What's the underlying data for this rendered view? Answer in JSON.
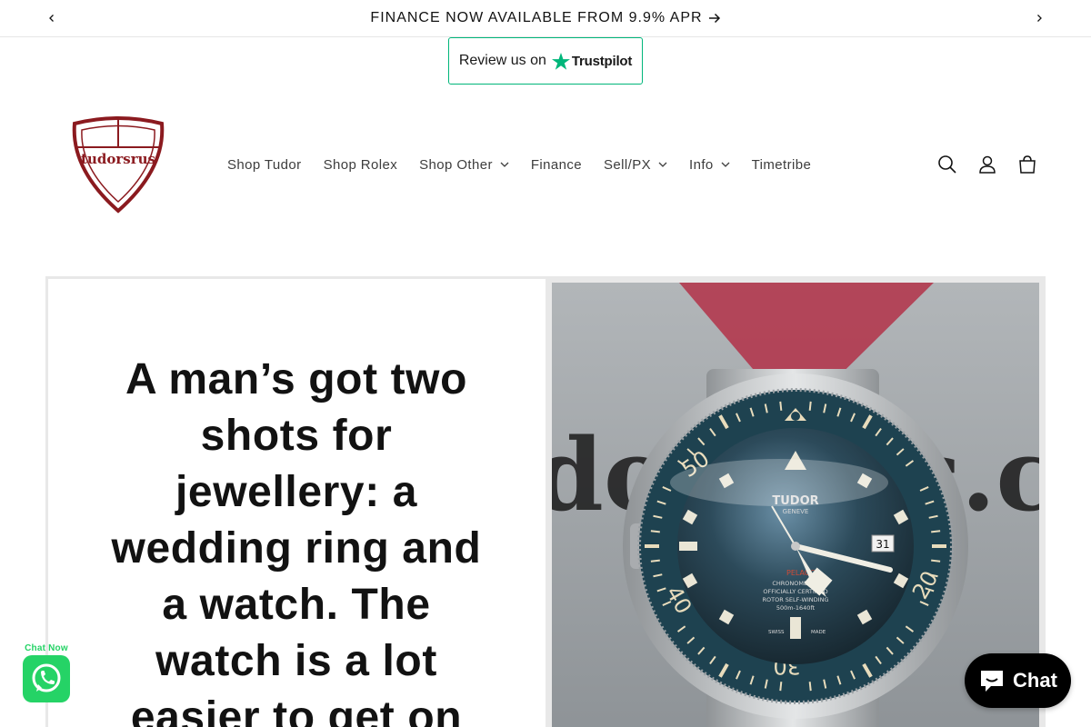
{
  "announcement": {
    "text": "FINANCE NOW AVAILABLE FROM 9.9% APR",
    "prev_icon": "chevron-left-icon",
    "next_icon": "chevron-right-icon"
  },
  "trustpilot": {
    "prefix": "Review us on",
    "brand": "Trustpilot",
    "star_color": "#00b67a"
  },
  "header": {
    "logo_text": "tudorsrus",
    "nav": [
      {
        "label": "Shop Tudor",
        "dropdown": false
      },
      {
        "label": "Shop Rolex",
        "dropdown": false
      },
      {
        "label": "Shop Other",
        "dropdown": true
      },
      {
        "label": "Finance",
        "dropdown": false
      },
      {
        "label": "Sell/PX",
        "dropdown": true
      },
      {
        "label": "Info",
        "dropdown": true
      },
      {
        "label": "Timetribe",
        "dropdown": false
      }
    ],
    "icons": [
      "search-icon",
      "account-icon",
      "cart-icon"
    ]
  },
  "hero": {
    "quote": "A man’s got two shots for jewellery: a wedding ring and a watch. The watch is a lot easier to get on",
    "watch": {
      "brand": "TUDOR",
      "city": "GENEVE",
      "model": "PELAGOS",
      "dial_lines": [
        "CHRONOMETER",
        "OFFICIALLY CERTIFIED",
        "ROTOR SELF-WINDING",
        "500m-1640ft"
      ],
      "footer_left": "SWISS",
      "footer_right": "MADE",
      "date": "31",
      "bezel_numbers": [
        "50",
        "20",
        "40",
        "30"
      ],
      "backdrop_text": "dorsrus.c"
    }
  },
  "whatsapp": {
    "label": "Chat Now",
    "color": "#25d366"
  },
  "chat": {
    "label": "Chat"
  },
  "colors": {
    "brand_red": "#8b1a1f",
    "border": "#e6e6e6"
  }
}
